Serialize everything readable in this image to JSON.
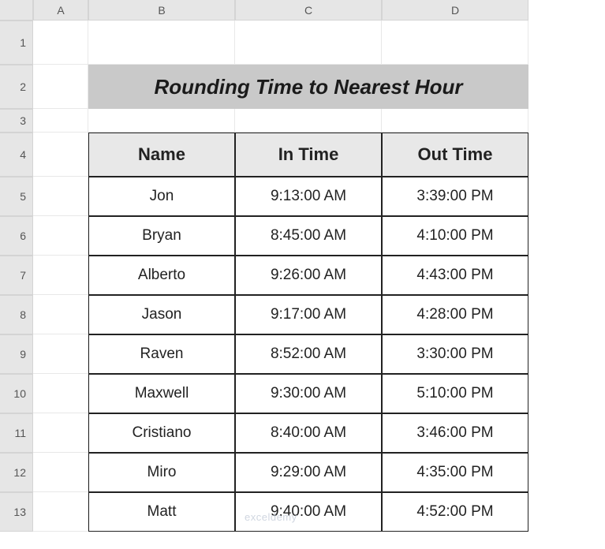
{
  "columns": [
    "A",
    "B",
    "C",
    "D"
  ],
  "rows": [
    "1",
    "2",
    "3",
    "4",
    "5",
    "6",
    "7",
    "8",
    "9",
    "10",
    "11",
    "12",
    "13"
  ],
  "title": "Rounding Time to Nearest Hour",
  "headers": {
    "name": "Name",
    "in": "In Time",
    "out": "Out Time"
  },
  "data": [
    {
      "name": "Jon",
      "in": "9:13:00 AM",
      "out": "3:39:00 PM"
    },
    {
      "name": "Bryan",
      "in": "8:45:00 AM",
      "out": "4:10:00 PM"
    },
    {
      "name": "Alberto",
      "in": "9:26:00 AM",
      "out": "4:43:00 PM"
    },
    {
      "name": "Jason",
      "in": "9:17:00 AM",
      "out": "4:28:00 PM"
    },
    {
      "name": "Raven",
      "in": "8:52:00 AM",
      "out": "3:30:00 PM"
    },
    {
      "name": "Maxwell",
      "in": "9:30:00 AM",
      "out": "5:10:00 PM"
    },
    {
      "name": "Cristiano",
      "in": "8:40:00 AM",
      "out": "3:46:00 PM"
    },
    {
      "name": "Miro",
      "in": "9:29:00 AM",
      "out": "4:35:00 PM"
    },
    {
      "name": "Matt",
      "in": "9:40:00 AM",
      "out": "4:52:00 PM"
    }
  ],
  "watermark": "exceldemy"
}
